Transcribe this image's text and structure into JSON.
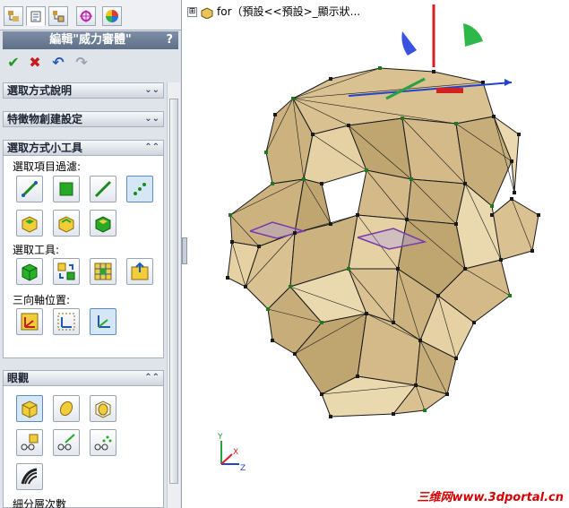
{
  "panel": {
    "tabs": [
      {
        "name": "feature-manager-tab",
        "icon": "feature-tree-icon"
      },
      {
        "name": "property-manager-tab",
        "icon": "property-manager-icon"
      },
      {
        "name": "configuration-manager-tab",
        "icon": "configuration-manager-icon"
      },
      {
        "name": "dimxpert-tab",
        "icon": "crosshair-icon"
      },
      {
        "name": "display-manager-tab",
        "icon": "color-wheel-icon"
      }
    ],
    "title": "編輯\"威力審體\"",
    "help": "?",
    "actions": {
      "ok": "✔",
      "cancel": "✖",
      "undo": "↶",
      "redo": "↷"
    },
    "sections": {
      "selection_help": "選取方式說明",
      "feature_create": "特徵物創建設定",
      "selection_tools": "選取方式小工具",
      "display": "眼觀"
    },
    "labels": {
      "filter": "選取項目過濾:",
      "tools": "選取工具:",
      "triad": "三向軸位置:",
      "subdiv": "細分層次數"
    },
    "chevrons": {
      "collapsed": "⌄⌄",
      "expanded": "⌃⌃"
    }
  },
  "graphics": {
    "tree_text": "for（預設<<預設>_顯示狀...",
    "tree_expander": "⊞",
    "axis_labels": {
      "x": "X",
      "y": "Y",
      "z": "Z"
    },
    "watermark": "三维网www.3dportal.cn"
  },
  "colors": {
    "face": "#d9c191",
    "edge": "#1a1a1a",
    "vertex": "#1f7a1f",
    "accent": "#5e6f88"
  }
}
